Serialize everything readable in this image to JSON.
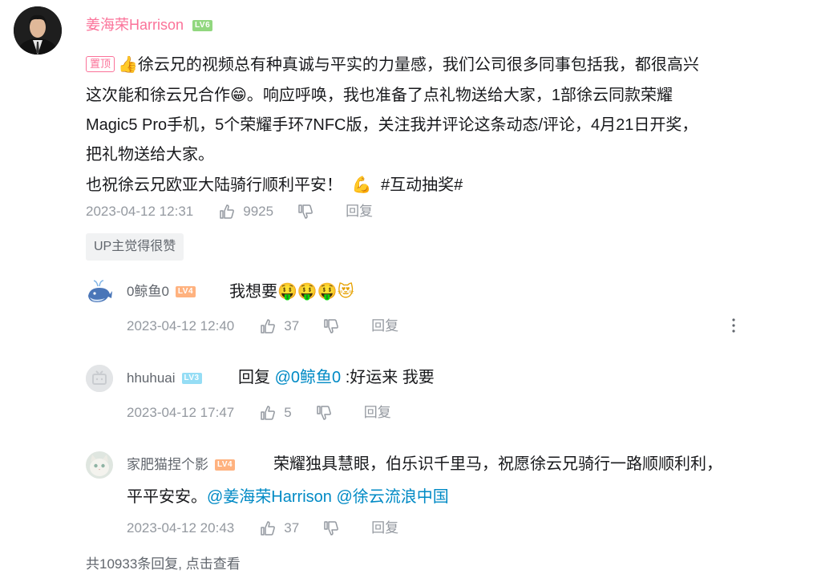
{
  "main_comment": {
    "username": "姜海荣Harrison",
    "level": "LV6",
    "pin_label": "置顶",
    "line1": "徐云兄的视频总有种真诚与平实的力量感，我们公司很多同事包括我，都很高兴",
    "line2": "这次能和徐云兄合作",
    "line2b": "。响应呼唤，我也准备了点礼物送给大家，1部徐云同款荣耀",
    "line3": "Magic5 Pro手机，5个荣耀手环7NFC版，关注我并评论这条动态/评论，4月21日开奖，",
    "line4": "把礼物送给大家。",
    "line5": "也祝徐云兄欧亚大陆骑行顺利平安！",
    "hashtag": "#互动抽奖#",
    "time": "2023-04-12 12:31",
    "likes": "9925",
    "reply_label": "回复",
    "up_badge": "UP主觉得很赞"
  },
  "replies": [
    {
      "username": "0鲸鱼0",
      "level": "LV4",
      "text": "我想要",
      "time": "2023-04-12 12:40",
      "likes": "37",
      "reply_label": "回复"
    },
    {
      "username": "hhuhuai",
      "level": "LV3",
      "reply_prefix": "回复",
      "mention": "@0鲸鱼0",
      "text": ":好运来 我要",
      "time": "2023-04-12 17:47",
      "likes": "5",
      "reply_label": "回复"
    },
    {
      "username": "家肥猫捏个影",
      "level": "LV4",
      "text_line1": "荣耀独具慧眼，伯乐识千里马，祝愿徐云兄骑行一路顺顺利利，",
      "text_line2": "平平安安。",
      "mention1": "@姜海荣Harrison",
      "mention2": "@徐云流浪中国",
      "time": "2023-04-12 20:43",
      "likes": "37",
      "reply_label": "回复"
    }
  ],
  "footer": "共10933条回复, 点击查看",
  "icons": {
    "like": "thumbs-up-icon",
    "dislike": "thumbs-down-icon",
    "more": "more-vertical-icon"
  },
  "colors": {
    "username_vip": "#fb7299",
    "mention": "#008ac5",
    "meta": "#9499a0"
  }
}
